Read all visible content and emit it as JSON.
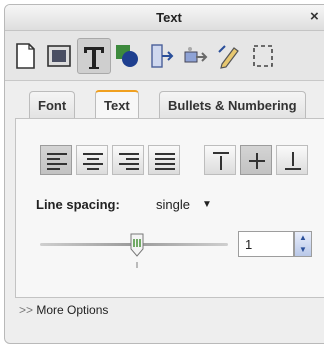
{
  "window": {
    "title": "Text",
    "close": "×"
  },
  "tabs": [
    {
      "label": "Font",
      "active": false
    },
    {
      "label": "Text",
      "active": true
    },
    {
      "label": "Bullets & Numbering",
      "active": false
    }
  ],
  "line_spacing": {
    "label": "Line spacing:",
    "value": "single",
    "arrow": "▼"
  },
  "spacing_field": {
    "value": "1"
  },
  "more_options": {
    "chevron": ">>",
    "label": "More Options"
  },
  "icons": {
    "toolbar": [
      "document-icon",
      "slide-layout-icon",
      "text-icon",
      "shapes-icon",
      "arrange-icon",
      "animation-icon",
      "pen-icon",
      "selection-icon"
    ],
    "align": [
      "align-left-icon",
      "align-center-icon",
      "align-right-icon",
      "justify-icon"
    ],
    "valign": [
      "align-top-icon",
      "align-middle-icon",
      "align-bottom-icon"
    ]
  },
  "colors": {
    "active_tab_accent": "#f0a020",
    "slider_thumb": "#3a8a2a",
    "spinner": "#2a4f9a"
  }
}
